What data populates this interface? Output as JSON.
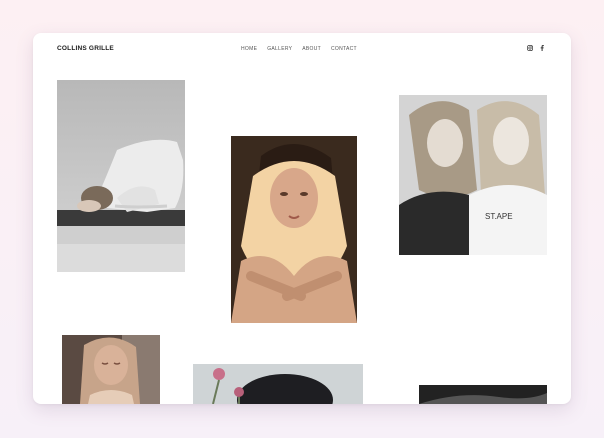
{
  "site": {
    "brand": "COLLINS GRILLE"
  },
  "nav": {
    "items": [
      "HOME",
      "GALLERY",
      "ABOUT",
      "CONTACT"
    ]
  },
  "social": {
    "icons": [
      "instagram-icon",
      "facebook-icon"
    ]
  },
  "gallery": {
    "photos": [
      {
        "name": "photo-yoga-pose",
        "tone": "grayscale"
      },
      {
        "name": "photo-woman-veil",
        "tone": "warm"
      },
      {
        "name": "photo-two-women",
        "tone": "grayscale"
      },
      {
        "name": "photo-woman-eyes-closed",
        "tone": "warm"
      },
      {
        "name": "photo-woman-flowers",
        "tone": "cool"
      },
      {
        "name": "photo-dark-partial",
        "tone": "grayscale"
      }
    ]
  },
  "colors": {
    "page_bg": "#fdf0f3",
    "window_bg": "#ffffff",
    "text": "#1a1a1a",
    "nav_text": "#555555"
  }
}
